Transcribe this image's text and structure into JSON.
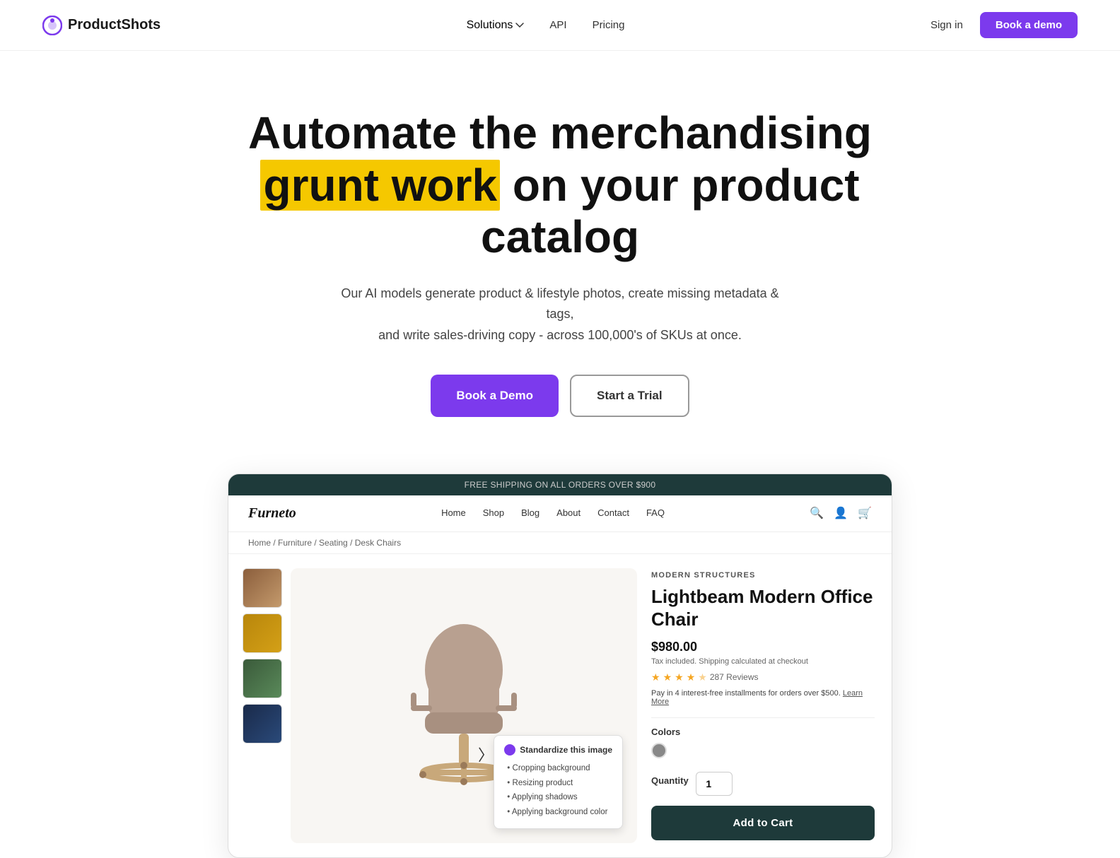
{
  "navbar": {
    "logo_text": "ProductShots",
    "nav_items": [
      {
        "id": "solutions",
        "label": "Solutions",
        "has_dropdown": true
      },
      {
        "id": "api",
        "label": "API",
        "has_dropdown": false
      },
      {
        "id": "pricing",
        "label": "Pricing",
        "has_dropdown": false
      }
    ],
    "signin_label": "Sign in",
    "book_demo_label": "Book a demo"
  },
  "hero": {
    "title_line1": "Automate the merchandising",
    "title_highlight": "grunt work",
    "title_line2": "on your product catalog",
    "subtitle_line1": "Our AI models generate product & lifestyle photos, create missing metadata & tags,",
    "subtitle_line2": "and write sales-driving copy - across 100,000's of SKUs at once.",
    "btn_demo": "Book a Demo",
    "btn_trial": "Start a Trial"
  },
  "store": {
    "topbar": "FREE SHIPPING ON ALL ORDERS OVER $900",
    "logo": "Furneto",
    "nav_items": [
      "Home",
      "Shop",
      "Blog",
      "About",
      "Contact",
      "FAQ"
    ],
    "breadcrumb": "Home / Furniture / Seating / Desk Chairs",
    "product": {
      "brand": "MODERN STRUCTURES",
      "name": "Lightbeam Modern Office Chair",
      "price": "$980.00",
      "tax_note": "Tax included. Shipping calculated at checkout",
      "rating": 4.5,
      "review_count": "287 Reviews",
      "installment": "Pay in 4 interest-free installments for orders over $500.",
      "installment_link": "Learn More",
      "colors_label": "Colors",
      "quantity_label": "Quantity",
      "quantity_value": "1",
      "add_to_cart_label": "Add to Cart",
      "tooltip_header": "Standardize this image",
      "tooltip_items": [
        "Cropping background",
        "Resizing product",
        "Applying shadows",
        "Applying background color"
      ]
    }
  }
}
